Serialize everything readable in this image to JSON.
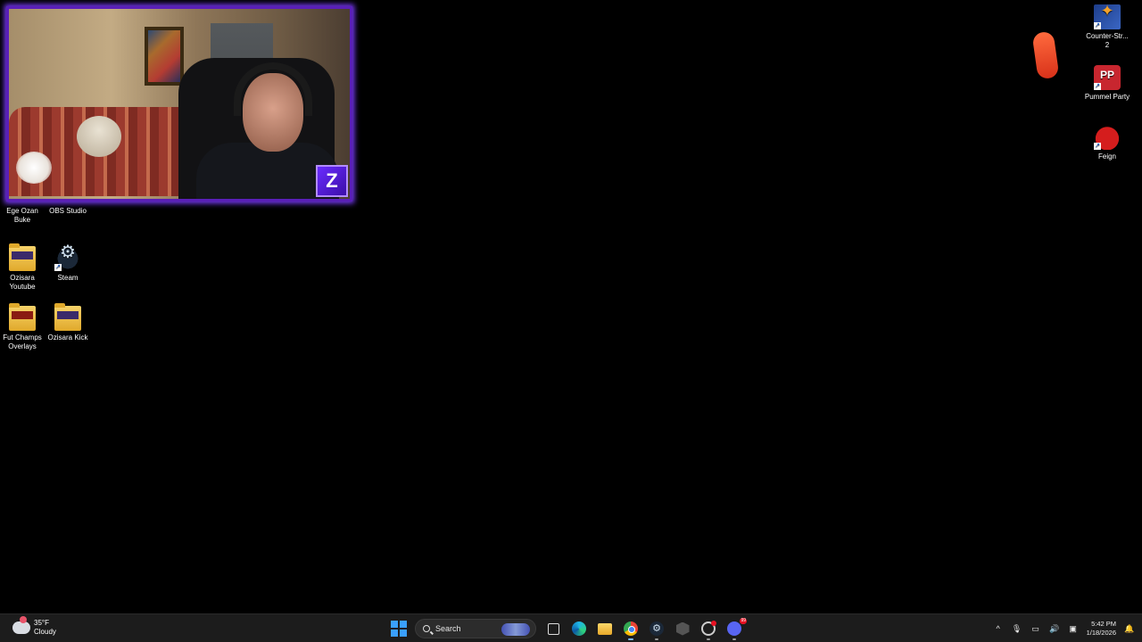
{
  "desktop": {
    "icons_left": [
      {
        "label": "Ege Ozan Buke",
        "icon": "folder-icon"
      },
      {
        "label": "OBS Studio",
        "icon": "obs-icon"
      },
      {
        "label": "Ozisara Youtube",
        "icon": "folder-icon"
      },
      {
        "label": "Steam",
        "icon": "steam-icon"
      },
      {
        "label": "Fut Champs Overlays",
        "icon": "folder-icon"
      },
      {
        "label": "Ozisara Kick",
        "icon": "folder-icon"
      }
    ],
    "icons_right": [
      {
        "label": "Counter-Str... 2",
        "icon": "counter-strike-icon"
      },
      {
        "label": "Pummel Party",
        "icon": "pummel-party-icon"
      },
      {
        "label": "Feign",
        "icon": "feign-icon"
      }
    ]
  },
  "webcam": {
    "logo_letter": "Z",
    "accent_color": "#5a1fb8"
  },
  "taskbar": {
    "weather": {
      "temp": "35°F",
      "condition": "Cloudy"
    },
    "search_label": "Search",
    "apps": [
      "start-icon",
      "task-view-icon",
      "edge-icon",
      "file-explorer-icon",
      "chrome-icon",
      "steam-icon",
      "hex-app-icon",
      "obs-icon",
      "discord-icon"
    ],
    "clock": {
      "time": "5:42 PM",
      "date": "1/18/2026"
    },
    "tray_chevron": "^"
  }
}
